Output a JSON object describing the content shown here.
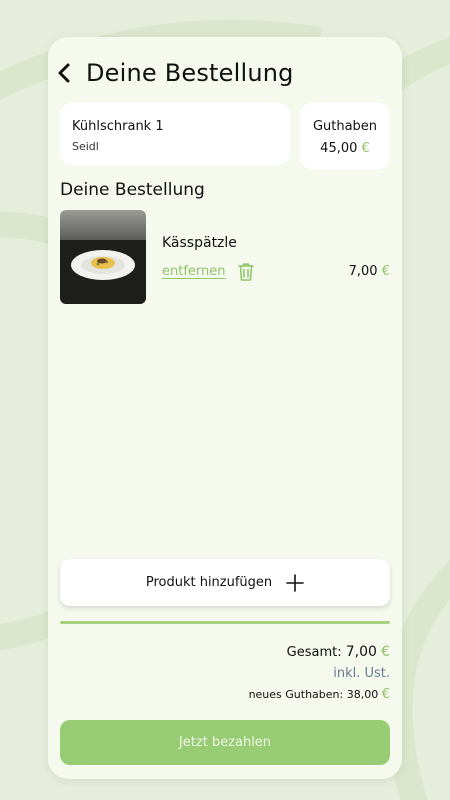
{
  "header": {
    "title": "Deine Bestellung"
  },
  "fridge": {
    "name": "Kühlschrank 1",
    "location": "Seidl"
  },
  "balance": {
    "label": "Guthaben",
    "amount": "45,00",
    "currency": "€"
  },
  "order": {
    "section_title": "Deine Bestellung",
    "items": [
      {
        "name": "Kässpätzle",
        "remove_label": "entfernen",
        "price": "7,00",
        "currency": "€"
      }
    ]
  },
  "add_product": {
    "label": "Produkt hinzufügen"
  },
  "summary": {
    "total_label": "Gesamt:",
    "total_amount": "7,00",
    "total_currency": "€",
    "tax_note": "inkl. Ust.",
    "new_balance_label": "neues Guthaben:",
    "new_balance_amount": "38,00",
    "new_balance_currency": "€"
  },
  "pay": {
    "label": "Jetzt bezahlen"
  },
  "colors": {
    "accent": "#8fc46a",
    "button": "#98cc74",
    "background": "#e6eedb",
    "card": "#f5f9ee"
  },
  "icons": {
    "back": "chevron-left-icon",
    "trash": "trash-icon",
    "plus": "plus-icon"
  }
}
